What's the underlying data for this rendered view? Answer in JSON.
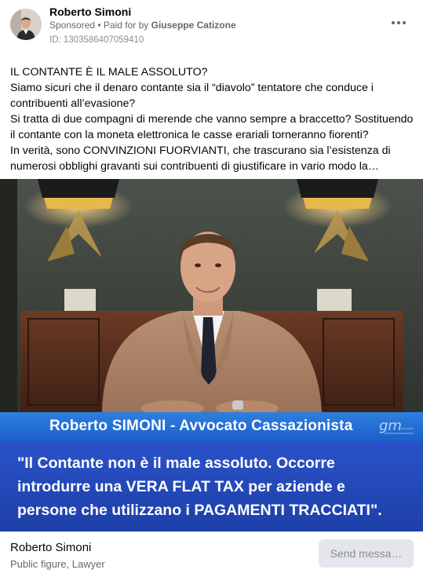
{
  "header": {
    "author_name": "Roberto Simoni",
    "sponsored_label": "Sponsored",
    "paid_for_prefix": " • Paid for by ",
    "payer_name": "Giuseppe Catizone",
    "ad_id": "ID: 1303586407059410",
    "more_icon": "more-horizontal-icon"
  },
  "body_lines": [
    "IL CONTANTE È IL MALE ASSOLUTO?",
    "Siamo sicuri che il denaro contante sia il “diavolo” tentatore che conduce i",
    "contribuenti all’evasione?",
    "Si tratta di due compagni di merende che vanno sempre a braccetto? Sostituendo",
    "il contante con la moneta elettronica le casse erariali torneranno fiorenti?",
    "In verità, sono CONVINZIONI FUORVIANTI, che trascurano sia l’esistenza di",
    "numerosi obblighi gravanti sui contribuenti di giustificare in vario modo la…"
  ],
  "media": {
    "name_band": "Roberto SIMONI -  Avvocato Cassazionista",
    "logo_text": "gm",
    "quote_lines": [
      "\"Il Contante non è il male assoluto. Occorre",
      "introdurre una VERA FLAT TAX per aziende e",
      "persone che utilizzano i PAGAMENTI TRACCIATI\"."
    ],
    "colors": {
      "name_band": "#2e7fe0",
      "quote_band": "#2a52c9"
    }
  },
  "footer": {
    "page_name": "Roberto Simoni",
    "page_category": "Public figure, Lawyer",
    "cta_label": "Send messa…"
  }
}
